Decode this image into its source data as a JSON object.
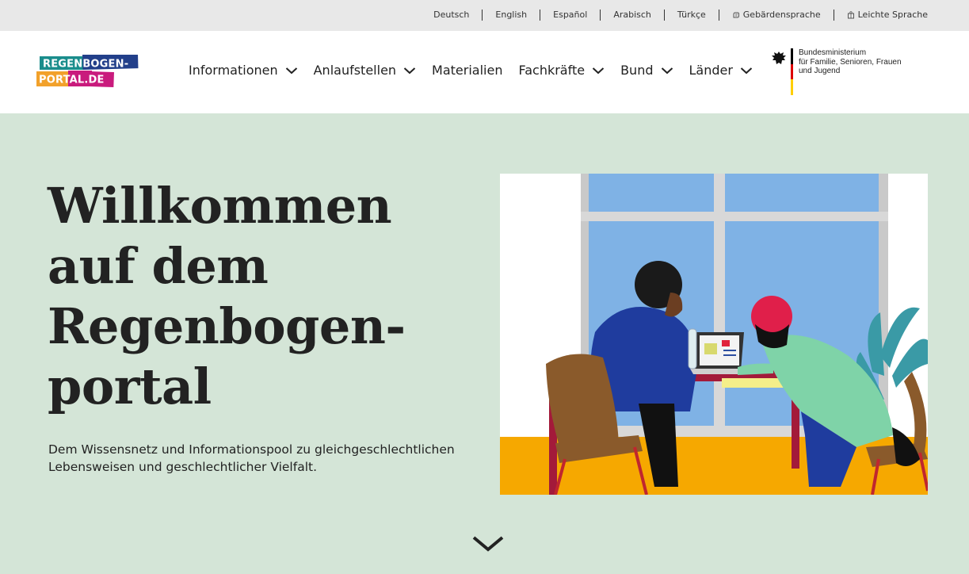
{
  "language_bar": {
    "items": [
      {
        "label": "Deutsch"
      },
      {
        "label": "English"
      },
      {
        "label": "Español"
      },
      {
        "label": "Arabisch"
      },
      {
        "label": "Türkçe"
      },
      {
        "label": "Gebärdensprache",
        "icon": "sign-language-icon"
      },
      {
        "label": "Leichte Sprache",
        "icon": "easy-language-icon"
      }
    ]
  },
  "header": {
    "logo": {
      "line1": "REGENBOGEN-",
      "line2": "PORTAL.DE"
    },
    "nav": [
      {
        "label": "Informationen",
        "has_dropdown": true
      },
      {
        "label": "Anlaufstellen",
        "has_dropdown": true
      },
      {
        "label": "Materialien",
        "has_dropdown": false
      },
      {
        "label": "Fachkräfte",
        "has_dropdown": true
      },
      {
        "label": "Bund",
        "has_dropdown": true
      },
      {
        "label": "Länder",
        "has_dropdown": true
      }
    ],
    "ministry": {
      "line1": "Bundesministerium",
      "line2": "für Familie, Senioren, Frauen",
      "line3": "und Jugend"
    }
  },
  "hero": {
    "title_lines": [
      "Willkommen",
      "auf dem",
      "Regenbogen-",
      "portal"
    ],
    "subtitle_line1": "Dem Wissensnetz und Informationspool zu gleichgeschlechtlichen",
    "subtitle_line2": "Lebensweisen und geschlechtlicher Vielfalt."
  },
  "colors": {
    "hero_background": "#d4e5d7",
    "header_background": "#ffffff",
    "language_bar_background": "#e8e8e8",
    "text": "#222222"
  }
}
